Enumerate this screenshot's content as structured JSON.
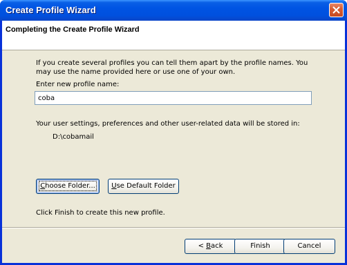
{
  "window": {
    "title": "Create Profile Wizard",
    "close_icon": "close-icon"
  },
  "header": {
    "title": "Completing the Create Profile Wizard"
  },
  "content": {
    "intro_text": "If you create several profiles you can tell them apart by the profile names. You may use the name provided here or use one of your own.",
    "profile_name_label": "Enter new profile name:",
    "profile_name_value": "coba",
    "storage_text": "Your user settings, preferences and other user-related data will be stored in:",
    "storage_path": "D:\\cobamail",
    "choose_folder": {
      "accel": "C",
      "rest": "hoose Folder..."
    },
    "use_default_folder": {
      "accel": "U",
      "rest": "se Default Folder"
    },
    "finish_hint": "Click Finish to create this new profile."
  },
  "footer": {
    "back": {
      "prefix": "< ",
      "accel": "B",
      "rest": "ack"
    },
    "finish_label": "Finish",
    "cancel_label": "Cancel"
  },
  "colors": {
    "title_bar": "#0054e3",
    "dialog_face": "#ece9d8",
    "close_button": "#d95e34"
  }
}
